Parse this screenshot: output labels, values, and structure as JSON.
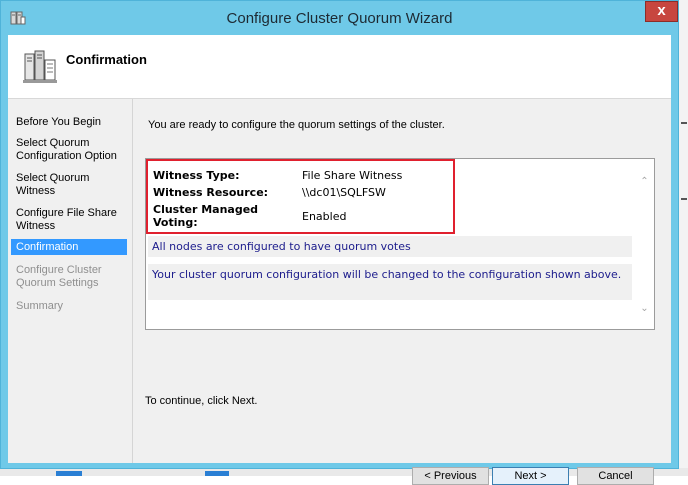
{
  "window": {
    "title": "Configure Cluster Quorum Wizard",
    "close_glyph": "x"
  },
  "header": {
    "title": "Confirmation"
  },
  "nav": {
    "items": [
      {
        "label": "Before You Begin",
        "state": "normal"
      },
      {
        "label": "Select Quorum Configuration Option",
        "state": "normal"
      },
      {
        "label": "Select Quorum Witness",
        "state": "normal"
      },
      {
        "label": "Configure File Share Witness",
        "state": "normal"
      },
      {
        "label": "Confirmation",
        "state": "selected"
      },
      {
        "label": "Configure Cluster Quorum Settings",
        "state": "disabled"
      },
      {
        "label": "Summary",
        "state": "disabled"
      }
    ]
  },
  "content": {
    "intro": "You are ready to configure the quorum settings of the cluster.",
    "summary": [
      {
        "label": "Witness Type:",
        "value": "File Share Witness"
      },
      {
        "label": "Witness Resource:",
        "value": "\\\\dc01\\SQLFSW"
      },
      {
        "label": "Cluster Managed Voting:",
        "value": "Enabled"
      }
    ],
    "info1": "All nodes are configured to have quorum votes",
    "info2": "Your cluster quorum configuration will be changed to the configuration shown above.",
    "continue": "To continue, click Next."
  },
  "buttons": {
    "previous": "< Previous",
    "next": "Next >",
    "cancel": "Cancel"
  },
  "colors": {
    "title_bar": "#6fc9e8",
    "selected": "#3399ff",
    "highlight_border": "#e0202e",
    "info_text": "#1c1c8c",
    "close_button": "#c7463f"
  }
}
